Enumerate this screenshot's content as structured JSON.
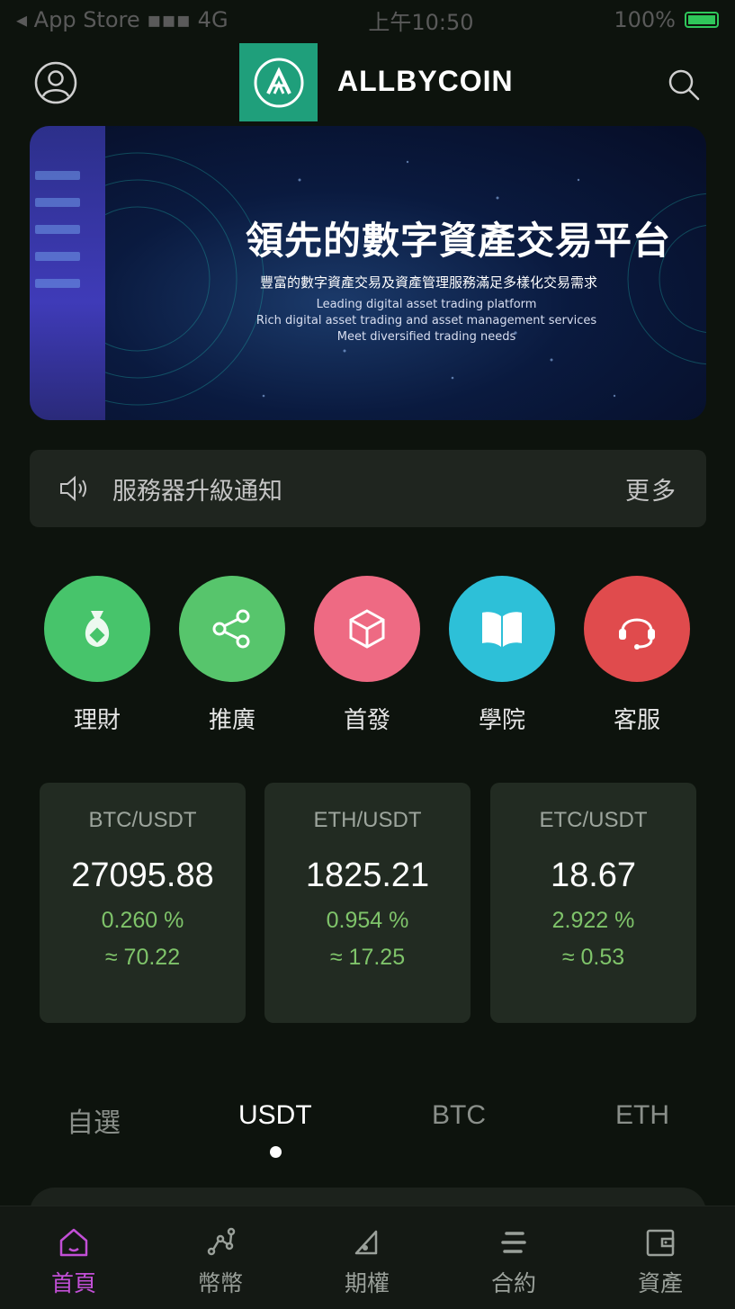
{
  "status_bar": {
    "carrier": "◂ App Store ▪▪▪ 4G",
    "time": "上午10:50",
    "battery": "100%"
  },
  "header": {
    "title": "ALLBYCOIN"
  },
  "banner": {
    "heading": "領先的數字資產交易平台",
    "subtitle_zh": "豐富的數字資產交易及資產管理服務滿足多樣化交易需求",
    "subtitle_en_1": "Leading digital asset trading platform",
    "subtitle_en_2": "Rich digital asset trading and asset management services",
    "subtitle_en_3": "Meet diversified trading needs"
  },
  "notice": {
    "text": "服務器升級通知",
    "more": "更多"
  },
  "quick_nav": [
    {
      "label": "理財",
      "color": "#47c46b",
      "icon": "money-bag-icon"
    },
    {
      "label": "推廣",
      "color": "#57c56c",
      "icon": "share-icon"
    },
    {
      "label": "首發",
      "color": "#ee6a83",
      "icon": "cube-icon"
    },
    {
      "label": "學院",
      "color": "#2dc0d8",
      "icon": "book-icon"
    },
    {
      "label": "客服",
      "color": "#e04b4d",
      "icon": "headset-icon"
    }
  ],
  "tickers": [
    {
      "pair": "BTC/USDT",
      "price": "27095.88",
      "change": "0.260 %",
      "approx": "≈ 70.22"
    },
    {
      "pair": "ETH/USDT",
      "price": "1825.21",
      "change": "0.954 %",
      "approx": "≈ 17.25"
    },
    {
      "pair": "ETC/USDT",
      "price": "18.67",
      "change": "2.922 %",
      "approx": "≈ 0.53"
    }
  ],
  "market_tabs": {
    "items": [
      "自選",
      "USDT",
      "BTC",
      "ETH"
    ],
    "active": "USDT"
  },
  "tab_bar": {
    "items": [
      {
        "label": "首頁",
        "icon": "home-icon"
      },
      {
        "label": "幣幣",
        "icon": "coin-trade-icon"
      },
      {
        "label": "期權",
        "icon": "options-icon"
      },
      {
        "label": "合約",
        "icon": "contract-icon"
      },
      {
        "label": "資產",
        "icon": "wallet-icon"
      }
    ],
    "active": "首頁",
    "active_color": "#c24fd6"
  }
}
